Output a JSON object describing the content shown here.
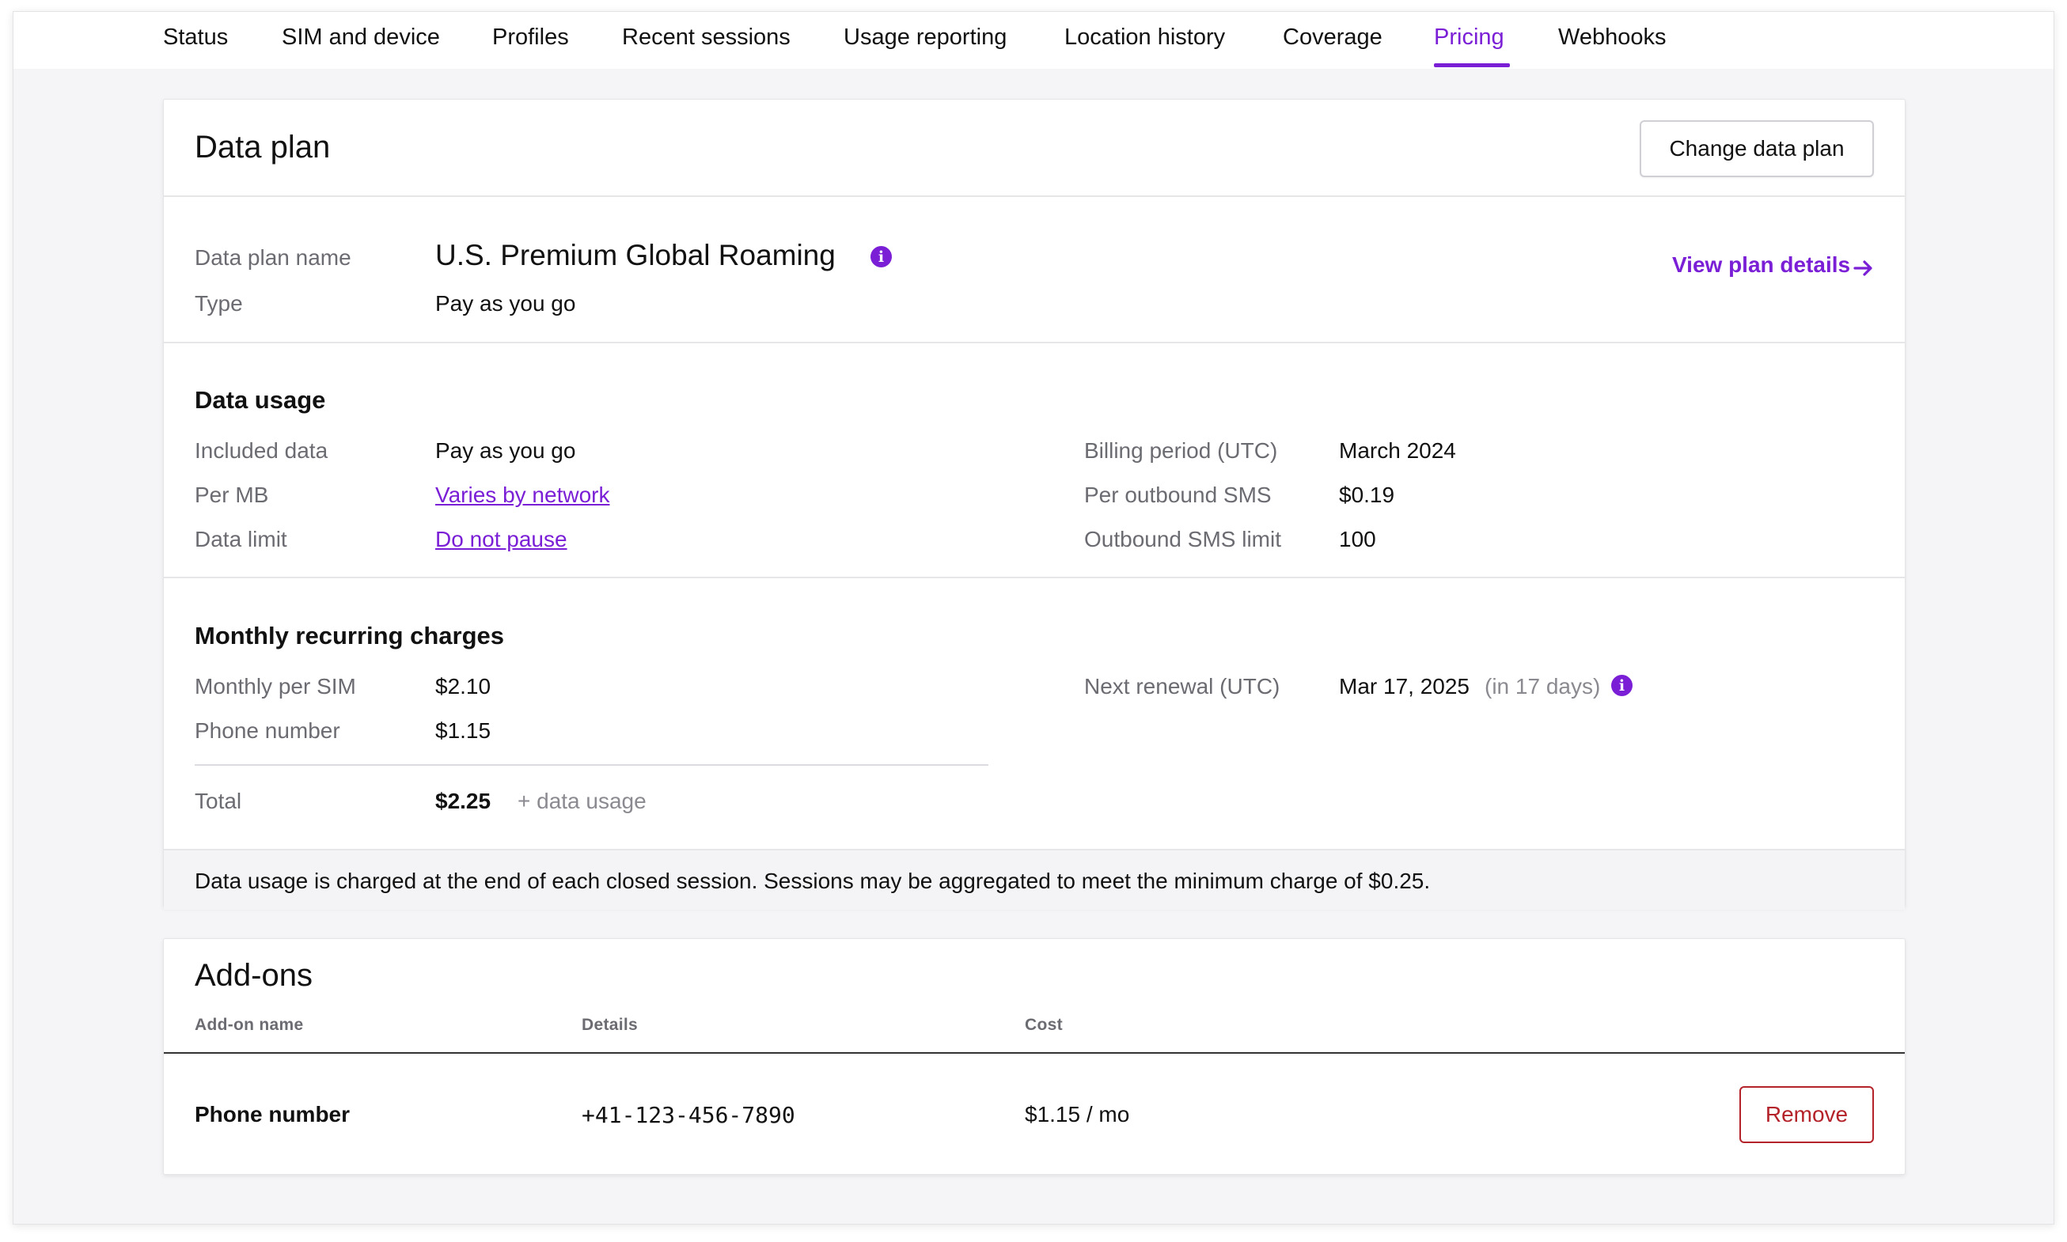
{
  "colors": {
    "accent": "#7a1fd6",
    "danger": "#b4232a",
    "muted": "#6b6b72"
  },
  "tabs": [
    {
      "label": "Status"
    },
    {
      "label": "SIM and device"
    },
    {
      "label": "Profiles"
    },
    {
      "label": "Recent sessions"
    },
    {
      "label": "Usage reporting"
    },
    {
      "label": "Location history"
    },
    {
      "label": "Coverage"
    },
    {
      "label": "Pricing",
      "active": true
    },
    {
      "label": "Webhooks"
    }
  ],
  "data_plan": {
    "title": "Data plan",
    "change_button": "Change data plan",
    "name_label": "Data plan name",
    "name_value": "U.S. Premium Global Roaming",
    "type_label": "Type",
    "type_value": "Pay as you go",
    "view_details": "View plan details",
    "view_details_icon": "arrow-right-icon"
  },
  "data_usage": {
    "title": "Data usage",
    "included_label": "Included data",
    "included_value": "Pay as you go",
    "per_mb_label": "Per MB",
    "per_mb_value": "Varies by network",
    "limit_label": "Data limit",
    "limit_value": "Do not pause",
    "billing_label": "Billing period (UTC)",
    "billing_value": "March 2024",
    "sms_label": "Per outbound SMS",
    "sms_value": "$0.19",
    "sms_limit_label": "Outbound SMS limit",
    "sms_limit_value": "100"
  },
  "monthly": {
    "title": "Monthly recurring charges",
    "per_sim_label": "Monthly per SIM",
    "per_sim_value": "$2.10",
    "phone_label": "Phone number",
    "phone_value": "$1.15",
    "total_label": "Total",
    "total_value": "$2.25",
    "total_suffix": "+ data usage",
    "renewal_label": "Next renewal (UTC)",
    "renewal_value": "Mar 17, 2025",
    "renewal_note": "(in 17 days)"
  },
  "notice": "Data usage is charged at the end of each closed session. Sessions may be aggregated to meet the minimum charge of $0.25.",
  "addons": {
    "title": "Add-ons",
    "columns": [
      "Add-on name",
      "Details",
      "Cost"
    ],
    "rows": [
      {
        "name": "Phone number",
        "details": "+41-123-456-7890",
        "cost": "$1.15 / mo",
        "action": "Remove"
      }
    ]
  }
}
